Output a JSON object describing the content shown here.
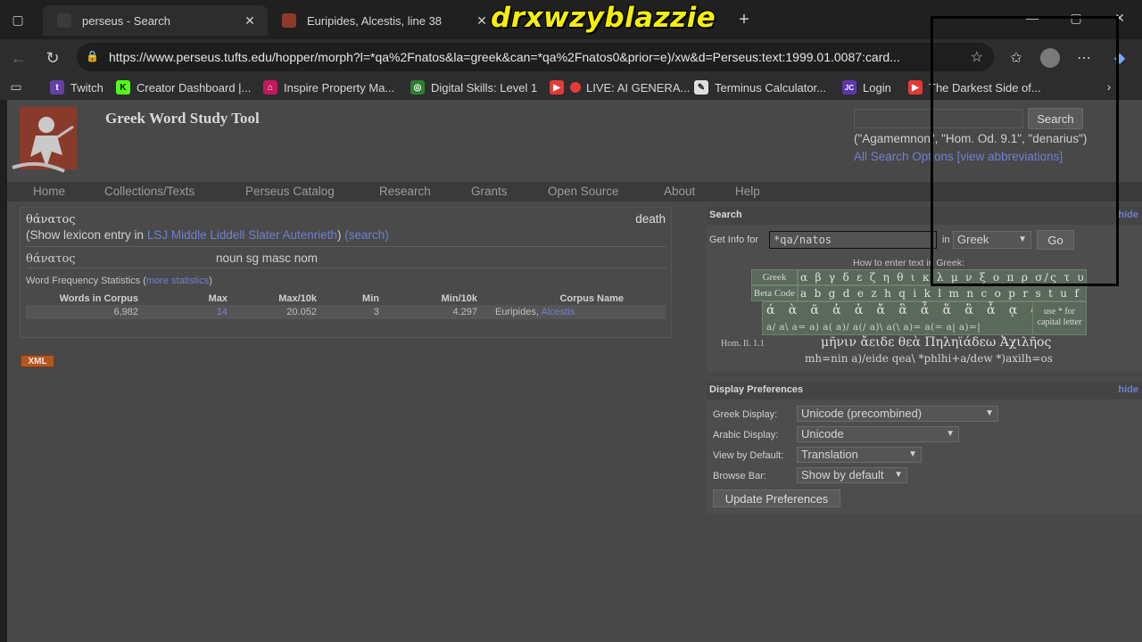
{
  "browser": {
    "tabs": [
      {
        "title": "perseus - Search",
        "close": "✕"
      },
      {
        "title": "Euripides, Alcestis, line 38",
        "close": "✕"
      },
      {
        "title": "",
        "close": "✕"
      }
    ],
    "new_tab": "+",
    "overlay_text": "drxwzyblazzie",
    "url": "https://www.perseus.tufts.edu/hopper/morph?l=*qa%2Fnatos&la=greek&can=*qa%2Fnatos0&prior=e)/xw&d=Perseus:text:1999.01.0087:card...",
    "bookmarks": [
      {
        "label": "Twitch",
        "icon": "twitch-icon",
        "color": "#6441a5",
        "glyph": "t"
      },
      {
        "label": "Creator Dashboard |...",
        "icon": "kick-icon",
        "color": "#53fc18",
        "glyph": "K"
      },
      {
        "label": "Inspire Property Ma...",
        "icon": "home-icon",
        "color": "#c2185b",
        "glyph": "⌂"
      },
      {
        "label": "Digital Skills: Level 1",
        "icon": "location-pin-icon",
        "color": "#2e7d32",
        "glyph": "◎"
      },
      {
        "label": "LIVE: AI GENERA...",
        "icon": "youtube-icon",
        "color": "#e53935",
        "glyph": "▶"
      },
      {
        "label": "Terminus Calculator...",
        "icon": "pencil-icon",
        "color": "#e0e0e0",
        "glyph": "✎"
      },
      {
        "label": "Login",
        "icon": "jc-icon",
        "color": "#5e35b1",
        "glyph": "JC"
      },
      {
        "label": "The Darkest Side of...",
        "icon": "youtube-icon",
        "color": "#e53935",
        "glyph": "▶"
      }
    ]
  },
  "site": {
    "title": "Greek Word Study Tool",
    "search_button": "Search",
    "search_examples": "(\"Agamemnon\", \"Hom. Od. 9.1\", \"denarius\")",
    "all_search_options": "All Search Options",
    "view_abbreviations": "[view abbreviations]",
    "nav": [
      "Home",
      "Collections/Texts",
      "Perseus Catalog",
      "Research",
      "Grants",
      "Open Source",
      "About",
      "Help"
    ]
  },
  "result": {
    "word": "θάνατος",
    "gloss": "death",
    "show_lexicon_prefix": "(Show lexicon entry in",
    "lexicons": [
      "LSJ",
      "Middle Liddell",
      "Slater",
      "Autenrieth"
    ],
    "search_link": "(search)",
    "close_paren": ")",
    "parse_word": "θάνατος",
    "parse_info": "noun sg masc nom",
    "freq_label": "Word Frequency Statistics (",
    "more_statistics": "more statistics",
    "freq_close": ")",
    "table_headers": [
      "Words in Corpus",
      "Max",
      "Max/10k",
      "Min",
      "Min/10k",
      "Corpus Name"
    ],
    "table_row": {
      "words": "6,982",
      "max": "14",
      "max10k": "20.052",
      "min": "3",
      "min10k": "4.297",
      "corpus_author": "Euripides,",
      "corpus_work": "Alcestis"
    },
    "xml_badge": "XML"
  },
  "search_panel": {
    "title": "Search",
    "hide": "hide",
    "get_info_label": "Get Info for",
    "input_value": "*qa/natos",
    "in_label": "in",
    "language": "Greek",
    "go": "Go",
    "howto": "How to enter text in Greek:",
    "greek_label": "Greek",
    "greek_chars": "α β γ δ ε ζ η θ ι κ λ μ ν ξ ο π ρ σ/ς τ υ φ χ ψ ω",
    "beta_label": "Beta Code",
    "beta_chars": "a b g d e z h q i k l m n c o p r  s  t u f x y w",
    "accent_chars": "ά ὰ ᾶ ἀ ἁ ἄ ἃ ἆ ἅ ἂ ἇ ᾳ ᾴ ᾅ",
    "accent_beta": "a/  a\\  a=  a)  a(  a)/  a(/  a)\\  a(\\  a)=  a(=  a|  a)=|",
    "capital_note": "use * for capital letter",
    "example_ref": "Hom. Il. 1.1",
    "example_greek": "μῆνιν ἄειδε θεὰ Πηληϊάδεω Ἀχιλῆος",
    "example_beta": "mh=nin a)/eide qea\\ *phlhi+a/dew *)axilh=os"
  },
  "prefs_panel": {
    "title": "Display Preferences",
    "hide": "hide",
    "greek_display_label": "Greek Display:",
    "greek_display_value": "Unicode (precombined)",
    "arabic_display_label": "Arabic Display:",
    "arabic_display_value": "Unicode",
    "view_default_label": "View by Default:",
    "view_default_value": "Translation",
    "browse_bar_label": "Browse Bar:",
    "browse_bar_value": "Show by default",
    "update_button": "Update Preferences"
  }
}
